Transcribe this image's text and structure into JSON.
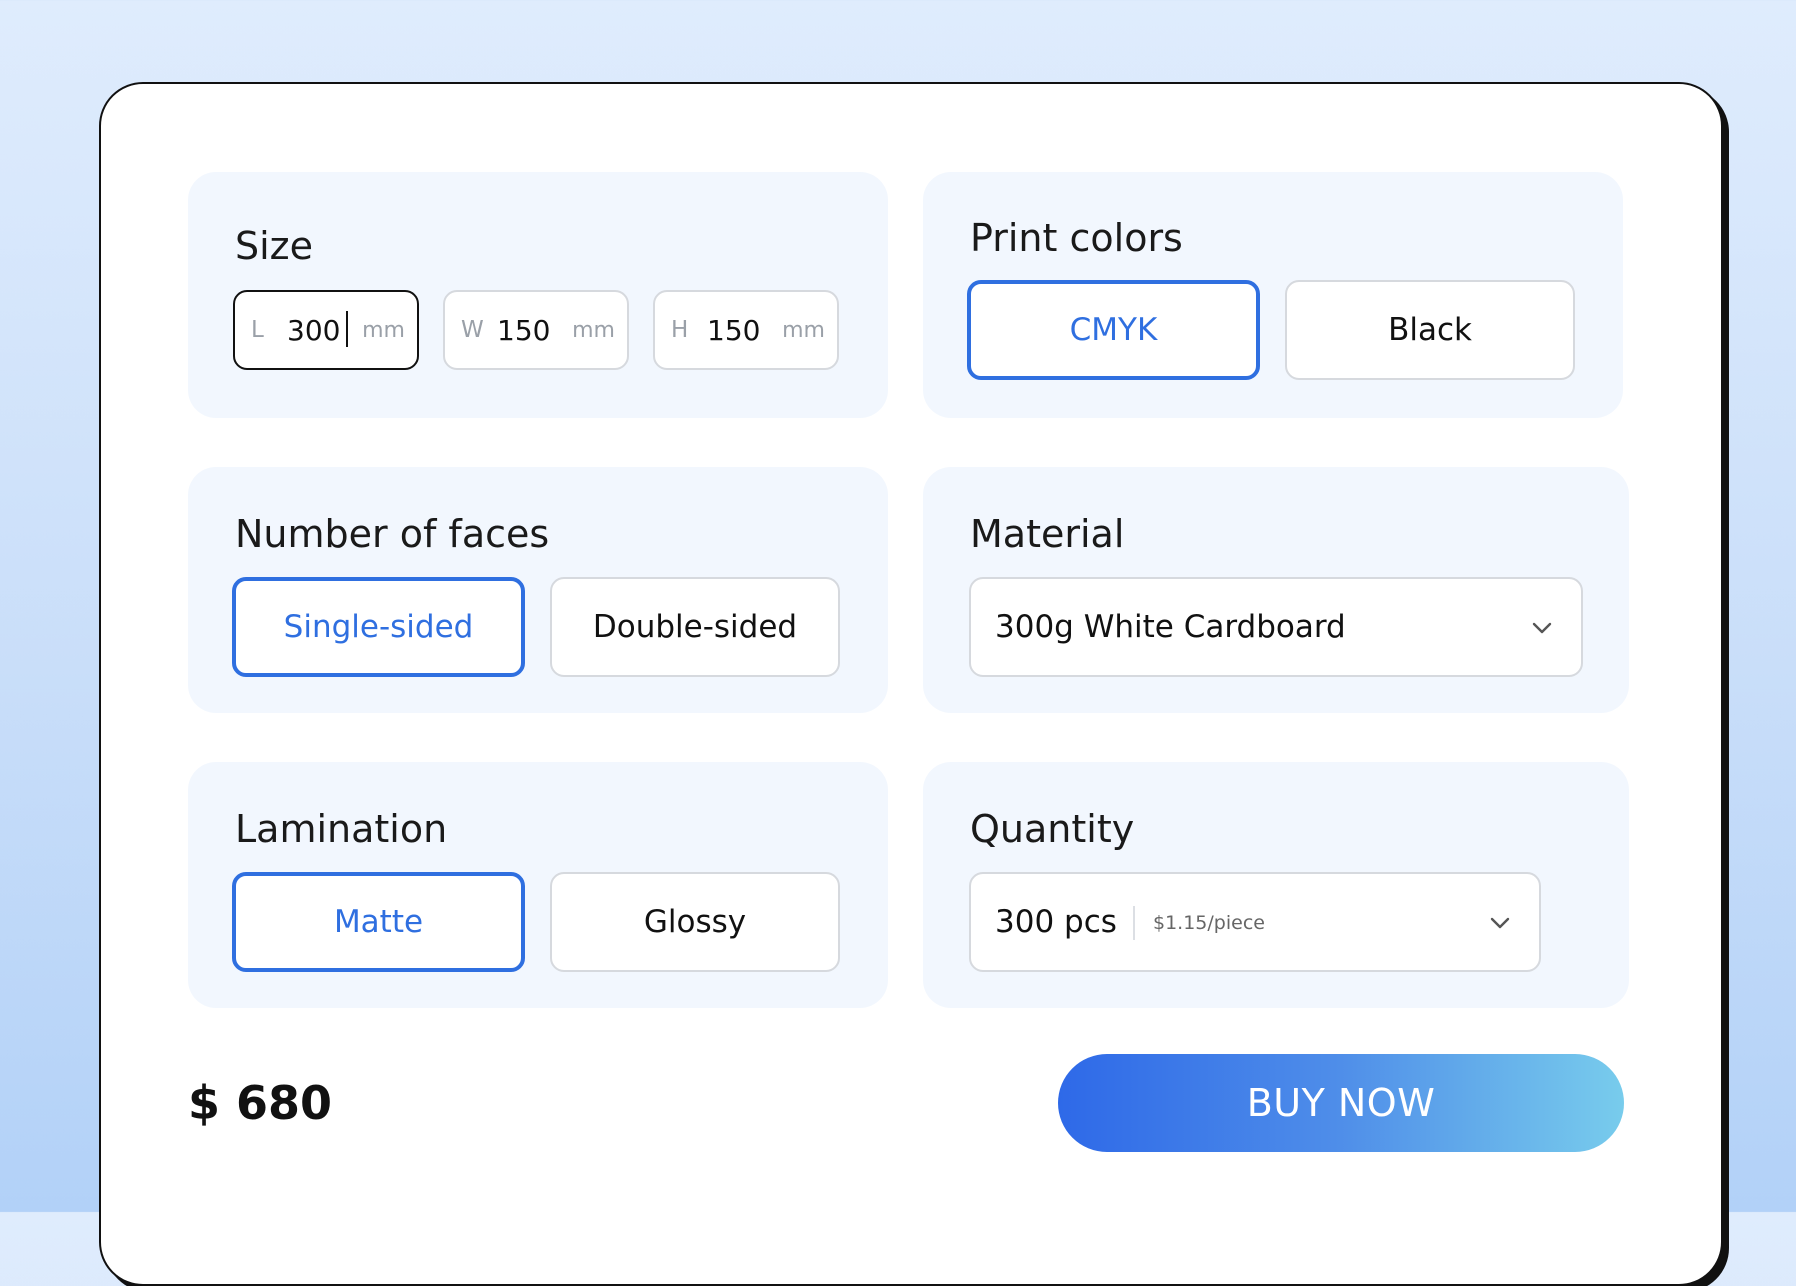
{
  "size": {
    "label": "Size",
    "fields": [
      {
        "prefix": "L",
        "value": "300",
        "unit": "mm"
      },
      {
        "prefix": "W",
        "value": "150",
        "unit": "mm"
      },
      {
        "prefix": "H",
        "value": "150",
        "unit": "mm"
      }
    ]
  },
  "print_colors": {
    "label": "Print colors",
    "options": [
      "CMYK",
      "Black"
    ],
    "selected": "CMYK"
  },
  "faces": {
    "label": "Number of faces",
    "options": [
      "Single-sided",
      "Double-sided"
    ],
    "selected": "Single-sided"
  },
  "material": {
    "label": "Material",
    "value": "300g White Cardboard"
  },
  "lamination": {
    "label": "Lamination",
    "options": [
      "Matte",
      "Glossy"
    ],
    "selected": "Matte"
  },
  "quantity": {
    "label": "Quantity",
    "value": "300 pcs",
    "unit_price": "$1.15/piece"
  },
  "total": "$ 680",
  "buy_label": "BUY NOW",
  "colors": {
    "accent": "#2f6fe0",
    "button_gradient_start": "#2e69e8",
    "button_gradient_end": "#78ccec",
    "panel_bg": "#f2f7fe"
  },
  "icons": {
    "dropdown": "chevron-down-icon"
  }
}
